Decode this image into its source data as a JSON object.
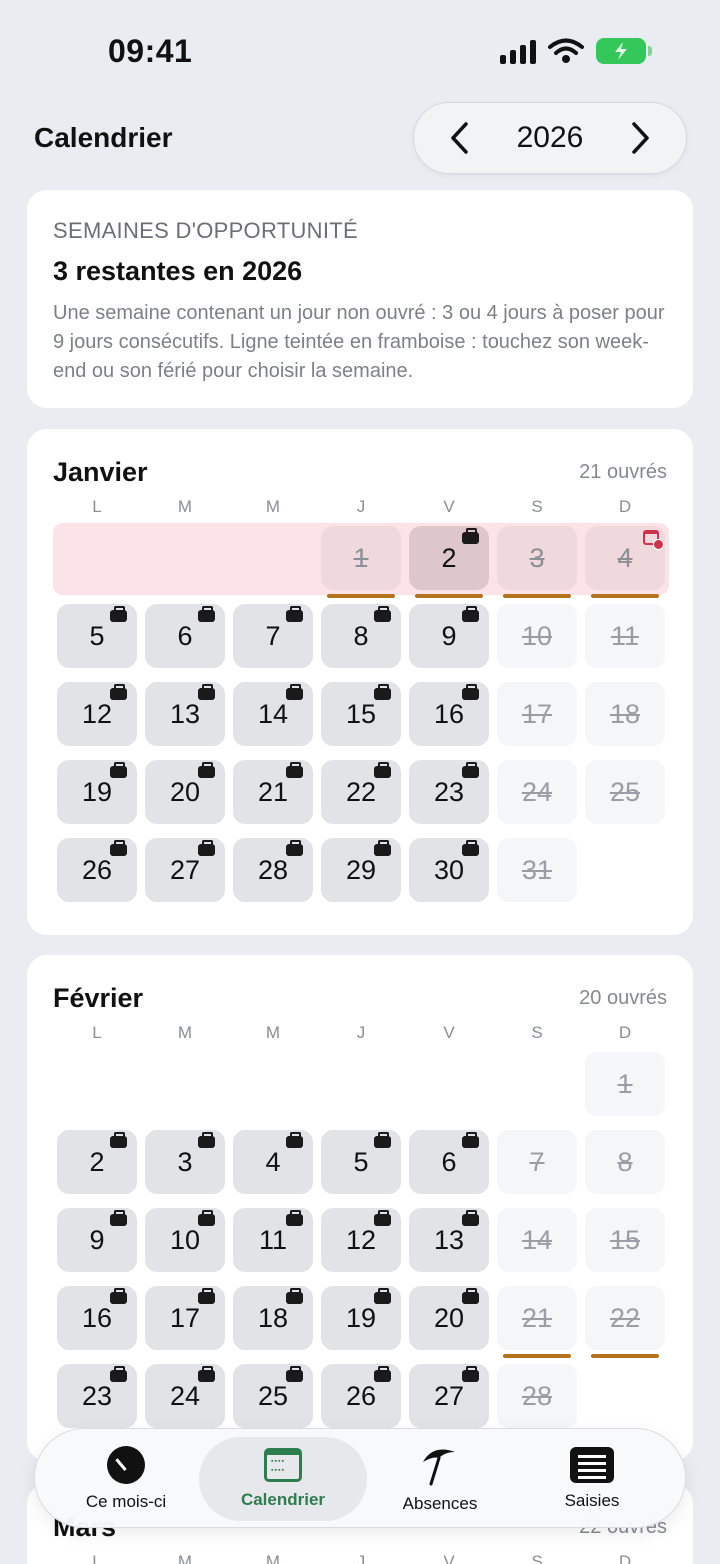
{
  "status": {
    "time": "09:41"
  },
  "header": {
    "title": "Calendrier",
    "year": "2026"
  },
  "opportunity": {
    "eyebrow": "SEMAINES D'OPPORTUNITÉ",
    "headline": "3 restantes en 2026",
    "description": "Une semaine contenant un jour non ouvré : 3 ou 4 jours à poser pour 9 jours consécutifs. Ligne teintée en framboise : touchez son week-end ou son férié pour choisir la semaine."
  },
  "weekdays": [
    "L",
    "M",
    "M",
    "J",
    "V",
    "S",
    "D"
  ],
  "months": [
    {
      "name": "Janvier",
      "count": "21 ouvrés",
      "first_col": 3,
      "days": 31,
      "off": [
        1,
        3,
        4,
        10,
        11,
        17,
        18,
        24,
        25,
        31
      ],
      "highlight_week": 0,
      "selected": 2,
      "underlined": [
        1,
        2,
        3,
        4
      ],
      "calendar_badge": [
        4
      ]
    },
    {
      "name": "Février",
      "count": "20 ouvrés",
      "first_col": 6,
      "days": 28,
      "off": [
        1,
        7,
        8,
        14,
        15,
        21,
        22,
        28
      ],
      "highlight_week": -1,
      "selected": 0,
      "underlined": [
        21,
        22
      ],
      "calendar_badge": []
    },
    {
      "name": "Mars",
      "count": "22 ouvrés"
    }
  ],
  "tabs": [
    {
      "label": "Ce mois-ci",
      "icon": "gauge-icon"
    },
    {
      "label": "Calendrier",
      "icon": "calendar-icon"
    },
    {
      "label": "Absences",
      "icon": "beach-umbrella-icon"
    },
    {
      "label": "Saisies",
      "icon": "list-icon"
    }
  ],
  "colors": {
    "accent": "#2E7D4F",
    "highlight": "#FBE3E7",
    "underline": "#B5731E",
    "holiday": "#D0314F"
  }
}
